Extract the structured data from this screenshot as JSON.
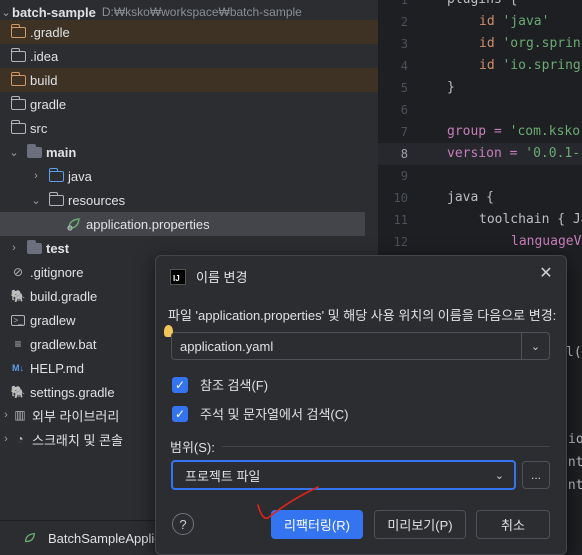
{
  "project_tree": {
    "root": {
      "name": "batch-sample",
      "path": "D:₩ksko₩workspace₩batch-sample"
    },
    "items": [
      {
        "label": ".gradle",
        "icon": "folder-icon"
      },
      {
        "label": ".idea",
        "icon": "folder-icon"
      },
      {
        "label": "build",
        "icon": "folder-icon"
      },
      {
        "label": "gradle",
        "icon": "folder-icon"
      },
      {
        "label": "src",
        "icon": "folder-icon"
      },
      {
        "label": "main",
        "icon": "folder-icon"
      },
      {
        "label": "java",
        "icon": "source-folder-icon"
      },
      {
        "label": "resources",
        "icon": "resources-folder-icon"
      },
      {
        "label": "application.properties",
        "icon": "spring-properties-icon"
      },
      {
        "label": "test",
        "icon": "folder-icon"
      },
      {
        "label": ".gitignore",
        "icon": "ignore-file-icon"
      },
      {
        "label": "build.gradle",
        "icon": "gradle-icon"
      },
      {
        "label": "gradlew",
        "icon": "terminal-file-icon"
      },
      {
        "label": "gradlew.bat",
        "icon": "text-file-icon"
      },
      {
        "label": "HELP.md",
        "icon": "markdown-icon"
      },
      {
        "label": "settings.gradle",
        "icon": "gradle-icon"
      },
      {
        "label": "외부 라이브러리",
        "icon": "libraries-icon"
      },
      {
        "label": "스크래치 및 콘솔",
        "icon": "scratches-icon"
      }
    ]
  },
  "editor": {
    "current_line": "8",
    "lines": [
      {
        "num": "1",
        "text": "plugins {"
      },
      {
        "num": "2",
        "kw": "id ",
        "str": "'java'"
      },
      {
        "num": "3",
        "kw": "id ",
        "str": "'org.sprin"
      },
      {
        "num": "4",
        "kw": "id ",
        "str": "'io.spring"
      },
      {
        "num": "5",
        "text": "}"
      },
      {
        "num": "6",
        "text": ""
      },
      {
        "num": "7",
        "kw": "group = ",
        "str": "'com.ksko"
      },
      {
        "num": "8",
        "kw": "version = ",
        "str": "'0.0.1-"
      },
      {
        "num": "9",
        "text": ""
      },
      {
        "num": "10",
        "text": "java {"
      },
      {
        "num": "11",
        "text": "toolchain { Ja"
      },
      {
        "num": "12",
        "text": "languageV"
      }
    ],
    "fragments": [
      "l(",
      "io",
      "ent",
      "ent"
    ]
  },
  "bottom_bar": {
    "run_config": "BatchSampleApplicat"
  },
  "dialog": {
    "title": "이름 변경",
    "prompt": "파일 'application.properties' 및 해당 사용 위치의 이름을 다음으로 변경:",
    "new_name": "application.yaml",
    "checkbox_references": "참조 검색(F)",
    "checkbox_comments": "주석 및 문자열에서 검색(C)",
    "scope_label": "범위(S):",
    "scope_value": "프로젝트 파일",
    "more_label": "...",
    "help_label": "?",
    "refactor_button": "리팩터링(R)",
    "preview_button": "미리보기(P)",
    "cancel_button": "취소"
  },
  "colors": {
    "accent": "#3574f0",
    "excluded_bg": "#3d3223",
    "annotation": "#e0241c"
  }
}
